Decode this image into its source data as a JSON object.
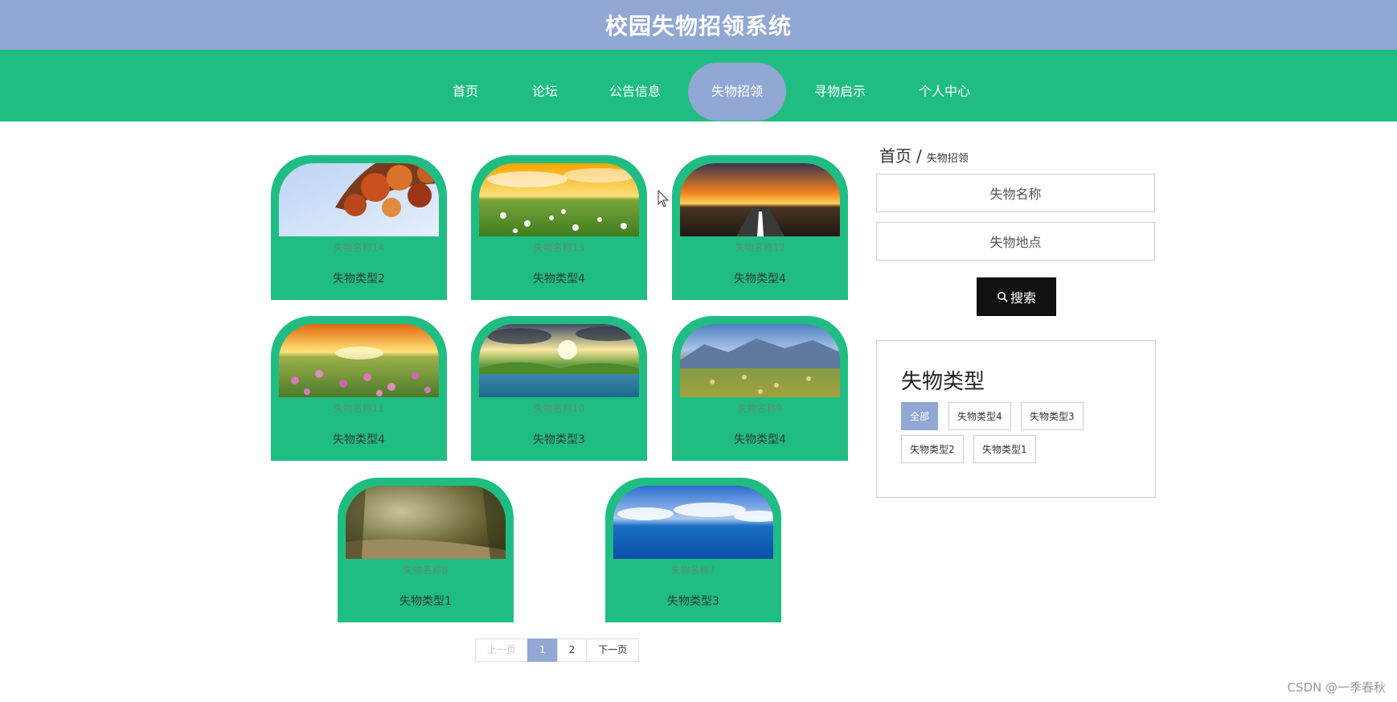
{
  "header": {
    "title": "校园失物招领系统"
  },
  "nav": {
    "items": [
      {
        "label": "首页"
      },
      {
        "label": "论坛"
      },
      {
        "label": "公告信息"
      },
      {
        "label": "失物招领",
        "active": true
      },
      {
        "label": "寻物启示"
      },
      {
        "label": "个人中心"
      }
    ]
  },
  "items": [
    {
      "name": "失物名称14",
      "type": "失物类型2",
      "image": "autumn-leaves"
    },
    {
      "name": "失物名称13",
      "type": "失物类型4",
      "image": "daisy-field-sunset"
    },
    {
      "name": "失物名称12",
      "type": "失物类型4",
      "image": "road-sunset"
    },
    {
      "name": "失物名称11",
      "type": "失物类型4",
      "image": "flower-meadow-sunrise"
    },
    {
      "name": "失物名称10",
      "type": "失物类型3",
      "image": "lake-sunburst"
    },
    {
      "name": "失物名称9",
      "type": "失物类型4",
      "image": "mountain-hay-field"
    },
    {
      "name": "失物名称8",
      "type": "失物类型1",
      "image": "forest-path"
    },
    {
      "name": "失物名称7",
      "type": "失物类型3",
      "image": "blue-sea-sky"
    }
  ],
  "pagination": {
    "prev": "上一页",
    "pages": [
      "1",
      "2"
    ],
    "current": "1",
    "next": "下一页"
  },
  "breadcrumb": {
    "home": "首页",
    "separator": "/",
    "current": "失物招领"
  },
  "search": {
    "name_placeholder": "失物名称",
    "location_placeholder": "失物地点",
    "button_label": "搜索"
  },
  "categories": {
    "title": "失物类型",
    "tags": [
      {
        "label": "全部",
        "active": true
      },
      {
        "label": "失物类型4"
      },
      {
        "label": "失物类型3"
      },
      {
        "label": "失物类型2"
      },
      {
        "label": "失物类型1"
      }
    ]
  },
  "watermark": "CSDN @一季春秋",
  "colors": {
    "header": "#91a7d4",
    "nav": "#20bd82",
    "card": "#20bd82",
    "accent": "#91a7d4",
    "button": "#111111"
  }
}
